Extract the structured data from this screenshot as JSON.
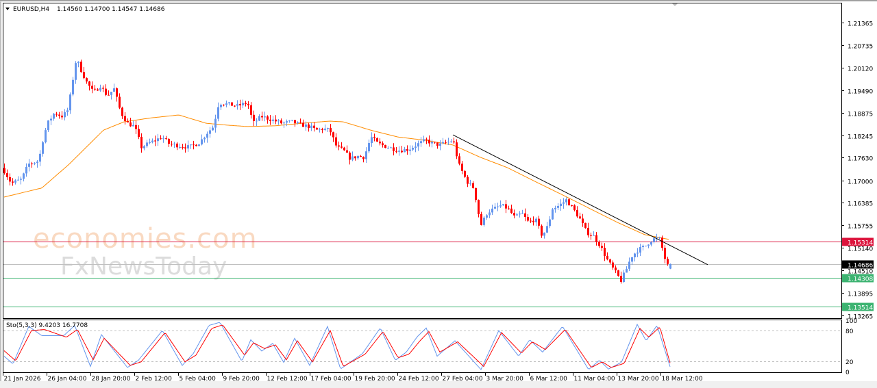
{
  "header": {
    "symbol": "EURUSD,H4",
    "ohlc": "1.14560 1.14700 1.14547 1.14686"
  },
  "watermark": {
    "line1": "economies.com",
    "line2": "FxNewsToday"
  },
  "colors": {
    "up": "#6495ED",
    "down": "#FF0000",
    "ma": "#FF8C00",
    "resistance": "#DC143C",
    "support": "#3CB371",
    "current": "#000000",
    "trendline": "#000000",
    "stoch_main": "#6495ED",
    "stoch_signal": "#FF0000"
  },
  "chart_data": {
    "type": "candlestick",
    "symbol": "EURUSD",
    "timeframe": "H4",
    "bar_count": 244,
    "ylim": [
      1.131,
      1.216
    ],
    "price_ticks": [
      "1.21365",
      "1.20735",
      "1.20120",
      "1.19490",
      "1.18875",
      "1.18245",
      "1.17630",
      "1.17000",
      "1.16385",
      "1.15755",
      "1.15140",
      "1.14510",
      "1.13895",
      "1.13265"
    ],
    "time_labels": [
      "21 Jan 2026",
      "26 Jan 04:00",
      "28 Jan 20:00",
      "2 Feb 12:00",
      "5 Feb 04:00",
      "9 Feb 20:00",
      "12 Feb 12:00",
      "17 Feb 04:00",
      "19 Feb 20:00",
      "24 Feb 12:00",
      "27 Feb 04:00",
      "3 Mar 20:00",
      "6 Mar 12:00",
      "11 Mar 04:00",
      "13 Mar 20:00",
      "18 Mar 12:00"
    ],
    "close_path": [
      [
        0,
        1.1726
      ],
      [
        2.5,
        1.1692
      ],
      [
        6.25,
        1.1703
      ],
      [
        8.75,
        1.1745
      ],
      [
        12.5,
        1.1754
      ],
      [
        14.25,
        1.182
      ],
      [
        15.75,
        1.1858
      ],
      [
        18.25,
        1.1887
      ],
      [
        21.25,
        1.1877
      ],
      [
        23.25,
        1.1896
      ],
      [
        25,
        1.1981
      ],
      [
        26.25,
        1.2038
      ],
      [
        28.25,
        1.2
      ],
      [
        30,
        1.1972
      ],
      [
        32.5,
        1.1943
      ],
      [
        35,
        1.1962
      ],
      [
        37.5,
        1.1934
      ],
      [
        40,
        1.1953
      ],
      [
        42.5,
        1.1887
      ],
      [
        45,
        1.1858
      ],
      [
        47.5,
        1.1849
      ],
      [
        50,
        1.1792
      ],
      [
        52.5,
        1.1802
      ],
      [
        55,
        1.1811
      ],
      [
        57.5,
        1.182
      ],
      [
        60,
        1.1802
      ],
      [
        63.75,
        1.1796
      ],
      [
        67.5,
        1.1792
      ],
      [
        71.25,
        1.1805
      ],
      [
        73.75,
        1.183
      ],
      [
        76.25,
        1.1849
      ],
      [
        78.25,
        1.1915
      ],
      [
        81.25,
        1.1911
      ],
      [
        85,
        1.1906
      ],
      [
        88.75,
        1.1915
      ],
      [
        90.75,
        1.1858
      ],
      [
        93.75,
        1.1877
      ],
      [
        97.5,
        1.1868
      ],
      [
        101.25,
        1.1858
      ],
      [
        105,
        1.1862
      ],
      [
        107.5,
        1.1855
      ],
      [
        111.25,
        1.1849
      ],
      [
        113.75,
        1.1839
      ],
      [
        116.25,
        1.1843
      ],
      [
        118.75,
        1.1839
      ],
      [
        121.25,
        1.1792
      ],
      [
        123.75,
        1.1783
      ],
      [
        126.25,
        1.176
      ],
      [
        128.75,
        1.1767
      ],
      [
        131.25,
        1.1764
      ],
      [
        133.75,
        1.182
      ],
      [
        136.25,
        1.1802
      ],
      [
        140,
        1.1792
      ],
      [
        143.75,
        1.1783
      ],
      [
        147.5,
        1.1786
      ],
      [
        151.25,
        1.1802
      ],
      [
        153.75,
        1.1811
      ],
      [
        156.25,
        1.1802
      ],
      [
        158.75,
        1.1798
      ],
      [
        161.25,
        1.1805
      ],
      [
        163.75,
        1.1811
      ],
      [
        165.75,
        1.1745
      ],
      [
        168.75,
        1.1697
      ],
      [
        171.25,
        1.1679
      ],
      [
        172.5,
        1.1631
      ],
      [
        173.75,
        1.1574
      ],
      [
        176.25,
        1.1612
      ],
      [
        178.75,
        1.1622
      ],
      [
        181.25,
        1.1631
      ],
      [
        183.75,
        1.1622
      ],
      [
        186.25,
        1.1597
      ],
      [
        188.75,
        1.1609
      ],
      [
        191.25,
        1.1584
      ],
      [
        193.75,
        1.1593
      ],
      [
        196.25,
        1.1546
      ],
      [
        198.25,
        1.1574
      ],
      [
        200,
        1.1622
      ],
      [
        202.5,
        1.1631
      ],
      [
        205,
        1.1646
      ],
      [
        207.5,
        1.1622
      ],
      [
        210,
        1.1593
      ],
      [
        212.5,
        1.1556
      ],
      [
        215,
        1.1546
      ],
      [
        217.5,
        1.1518
      ],
      [
        220,
        1.148
      ],
      [
        222.5,
        1.1451
      ],
      [
        225,
        1.1423
      ],
      [
        226.75,
        1.1451
      ],
      [
        228.75,
        1.1489
      ],
      [
        231.25,
        1.1508
      ],
      [
        233.75,
        1.1518
      ],
      [
        235.75,
        1.1533
      ],
      [
        237.5,
        1.154
      ],
      [
        239.25,
        1.1537
      ],
      [
        240.75,
        1.1489
      ],
      [
        242.5,
        1.1455
      ],
      [
        243,
        1.14686
      ]
    ],
    "last_bar": {
      "open": 1.1456,
      "high": 1.147,
      "low": 1.14547,
      "close": 1.14686
    },
    "moving_average_path": [
      [
        0,
        1.1654
      ],
      [
        13.75,
        1.1679
      ],
      [
        23.75,
        1.1745
      ],
      [
        36.25,
        1.1839
      ],
      [
        43.75,
        1.1862
      ],
      [
        53.75,
        1.1873
      ],
      [
        63.75,
        1.1881
      ],
      [
        73.75,
        1.1858
      ],
      [
        81.25,
        1.1853
      ],
      [
        88.75,
        1.1849
      ],
      [
        98.75,
        1.1851
      ],
      [
        108.75,
        1.1858
      ],
      [
        118.75,
        1.1864
      ],
      [
        123.75,
        1.1862
      ],
      [
        133.75,
        1.1839
      ],
      [
        143.75,
        1.182
      ],
      [
        153.75,
        1.1811
      ],
      [
        163.75,
        1.1798
      ],
      [
        173.75,
        1.1764
      ],
      [
        183.75,
        1.1735
      ],
      [
        193.75,
        1.1697
      ],
      [
        203.75,
        1.166
      ],
      [
        213.75,
        1.1622
      ],
      [
        223.75,
        1.1584
      ],
      [
        233.75,
        1.155
      ],
      [
        242.5,
        1.1537
      ]
    ],
    "trendline": [
      [
        163.75,
        1.1826
      ],
      [
        256.75,
        1.1467
      ]
    ],
    "levels": [
      {
        "name": "resistance",
        "price": 1.15314,
        "label": "1.15314"
      },
      {
        "name": "current",
        "price": 1.14686,
        "label": "1.14686"
      },
      {
        "name": "support-1",
        "price": 1.14308,
        "label": "1.14308"
      },
      {
        "name": "support-2",
        "price": 1.13514,
        "label": "1.13514"
      }
    ],
    "stochastic": {
      "label": "Sto(5,3,3) 9.4203 16.7708",
      "ylim": [
        0,
        100
      ],
      "levels": [
        80,
        20
      ],
      "axis_labels": [
        "100",
        "80",
        "20",
        "0"
      ],
      "main_value": 9.4203,
      "signal_value": 16.7708,
      "main_path": [
        [
          0,
          30
        ],
        [
          3.25,
          15
        ],
        [
          9,
          88
        ],
        [
          13.75,
          70
        ],
        [
          21.75,
          70
        ],
        [
          25.75,
          90
        ],
        [
          31.5,
          10
        ],
        [
          35.5,
          72
        ],
        [
          45,
          8
        ],
        [
          49,
          22
        ],
        [
          57.75,
          80
        ],
        [
          65,
          12
        ],
        [
          69,
          35
        ],
        [
          74.75,
          90
        ],
        [
          78.75,
          96
        ],
        [
          86.75,
          20
        ],
        [
          90,
          62
        ],
        [
          94,
          40
        ],
        [
          98,
          55
        ],
        [
          102,
          18
        ],
        [
          106,
          65
        ],
        [
          111.5,
          12
        ],
        [
          118,
          88
        ],
        [
          122.75,
          5
        ],
        [
          130.75,
          35
        ],
        [
          137.25,
          85
        ],
        [
          142.75,
          22
        ],
        [
          146.75,
          38
        ],
        [
          150.75,
          68
        ],
        [
          154,
          85
        ],
        [
          158,
          30
        ],
        [
          164.5,
          60
        ],
        [
          174,
          4
        ],
        [
          180.5,
          80
        ],
        [
          187.75,
          30
        ],
        [
          191.75,
          62
        ],
        [
          196.5,
          38
        ],
        [
          203.75,
          88
        ],
        [
          213.25,
          4
        ],
        [
          217.25,
          22
        ],
        [
          220.5,
          5
        ],
        [
          225.25,
          18
        ],
        [
          231,
          92
        ],
        [
          234.25,
          60
        ],
        [
          238.25,
          90
        ],
        [
          243,
          9.42
        ]
      ],
      "signal_path": [
        [
          0,
          40.6
        ],
        [
          4.25,
          21
        ],
        [
          10,
          80
        ],
        [
          14.75,
          82
        ],
        [
          22.75,
          67
        ],
        [
          26.75,
          82
        ],
        [
          32.5,
          23
        ],
        [
          36.5,
          65
        ],
        [
          46,
          12
        ],
        [
          50,
          19
        ],
        [
          58.75,
          76
        ],
        [
          66,
          19
        ],
        [
          70,
          32
        ],
        [
          75.75,
          84
        ],
        [
          79.75,
          91
        ],
        [
          87.75,
          32
        ],
        [
          91,
          56
        ],
        [
          95,
          45
        ],
        [
          99,
          52
        ],
        [
          103,
          23
        ],
        [
          107,
          60
        ],
        [
          112.5,
          19
        ],
        [
          119,
          80
        ],
        [
          123.75,
          10
        ],
        [
          131.75,
          34
        ],
        [
          138.25,
          78
        ],
        [
          143.75,
          27
        ],
        [
          147.75,
          34
        ],
        [
          151.75,
          60
        ],
        [
          155,
          78
        ],
        [
          159,
          38
        ],
        [
          165.5,
          58
        ],
        [
          175,
          10
        ],
        [
          181.5,
          76
        ],
        [
          188.75,
          36
        ],
        [
          192.75,
          58
        ],
        [
          197.5,
          43
        ],
        [
          204.75,
          82
        ],
        [
          214.25,
          8
        ],
        [
          218.25,
          19
        ],
        [
          221.5,
          8
        ],
        [
          226.25,
          16
        ],
        [
          232,
          84
        ],
        [
          235.25,
          67
        ],
        [
          239.25,
          87
        ],
        [
          243,
          16.77
        ]
      ]
    }
  }
}
